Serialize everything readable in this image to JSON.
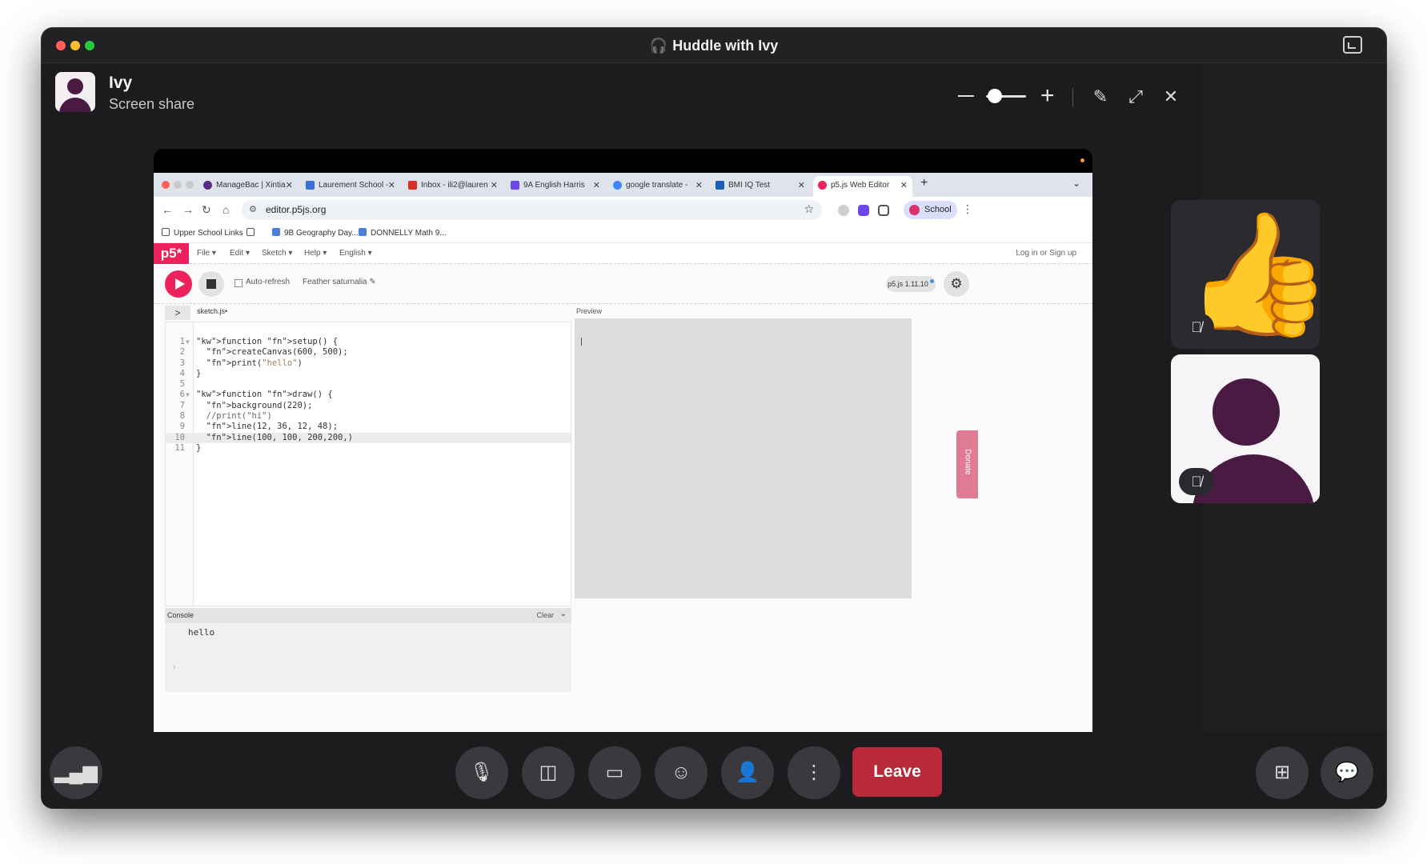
{
  "window": {
    "title": "Huddle with Ivy"
  },
  "presenter": {
    "name": "Ivy",
    "subtitle": "Screen share"
  },
  "browser": {
    "tabs": [
      {
        "label": "ManageBac | Xintia",
        "favicon_color": "#5b2a86"
      },
      {
        "label": "Laurement School -",
        "favicon_color": "#3b6fd8"
      },
      {
        "label": "Inbox - ili2@lauren",
        "favicon_color": "#d93025"
      },
      {
        "label": "9A English Harris",
        "favicon_color": "#7048e8"
      },
      {
        "label": "google translate -",
        "favicon_color": "#4285f4"
      },
      {
        "label": "BMI IQ Test",
        "favicon_color": "#1a5fb4"
      },
      {
        "label": "p5.js Web Editor",
        "favicon_color": "#ed225d",
        "active": true
      }
    ],
    "url": "editor.p5js.org",
    "profile_label": "School",
    "bookmarks": [
      {
        "label": "Upper School Links"
      },
      {
        "label": "9B Geography Day..."
      },
      {
        "label": "DONNELLY Math 9..."
      }
    ]
  },
  "p5": {
    "logo": "p5*",
    "menus": [
      "File ▾",
      "Edit ▾",
      "Sketch ▾",
      "Help ▾",
      "English ▾"
    ],
    "login": "Log in",
    "or": "or",
    "signup": "Sign up",
    "auto_refresh": "Auto-refresh",
    "sketch_name": "Feather saturnalia ✎",
    "version": "p5.js 1.11.10",
    "file_name": "sketch.js",
    "preview_label": "Preview",
    "donate": "Donate",
    "console_title": "Console",
    "console_clear": "Clear",
    "console_output": "hello",
    "code_lines": [
      {
        "n": "1",
        "fold": true,
        "text": "function setup() {"
      },
      {
        "n": "2",
        "text": "  createCanvas(600, 500);"
      },
      {
        "n": "3",
        "text": "  print(\"hello\")"
      },
      {
        "n": "4",
        "text": "}"
      },
      {
        "n": "5",
        "text": ""
      },
      {
        "n": "6",
        "fold": true,
        "text": "function draw() {"
      },
      {
        "n": "7",
        "text": "  background(220);"
      },
      {
        "n": "8",
        "text": "  //print(\"hi\")"
      },
      {
        "n": "9",
        "text": "  line(12, 36, 12, 48);"
      },
      {
        "n": "10",
        "text": "  line(100, 100, 200,200,)",
        "highlight": true
      },
      {
        "n": "11",
        "text": "}"
      }
    ]
  },
  "controls": {
    "leave_label": "Leave",
    "leave_color": "#b8293a"
  }
}
